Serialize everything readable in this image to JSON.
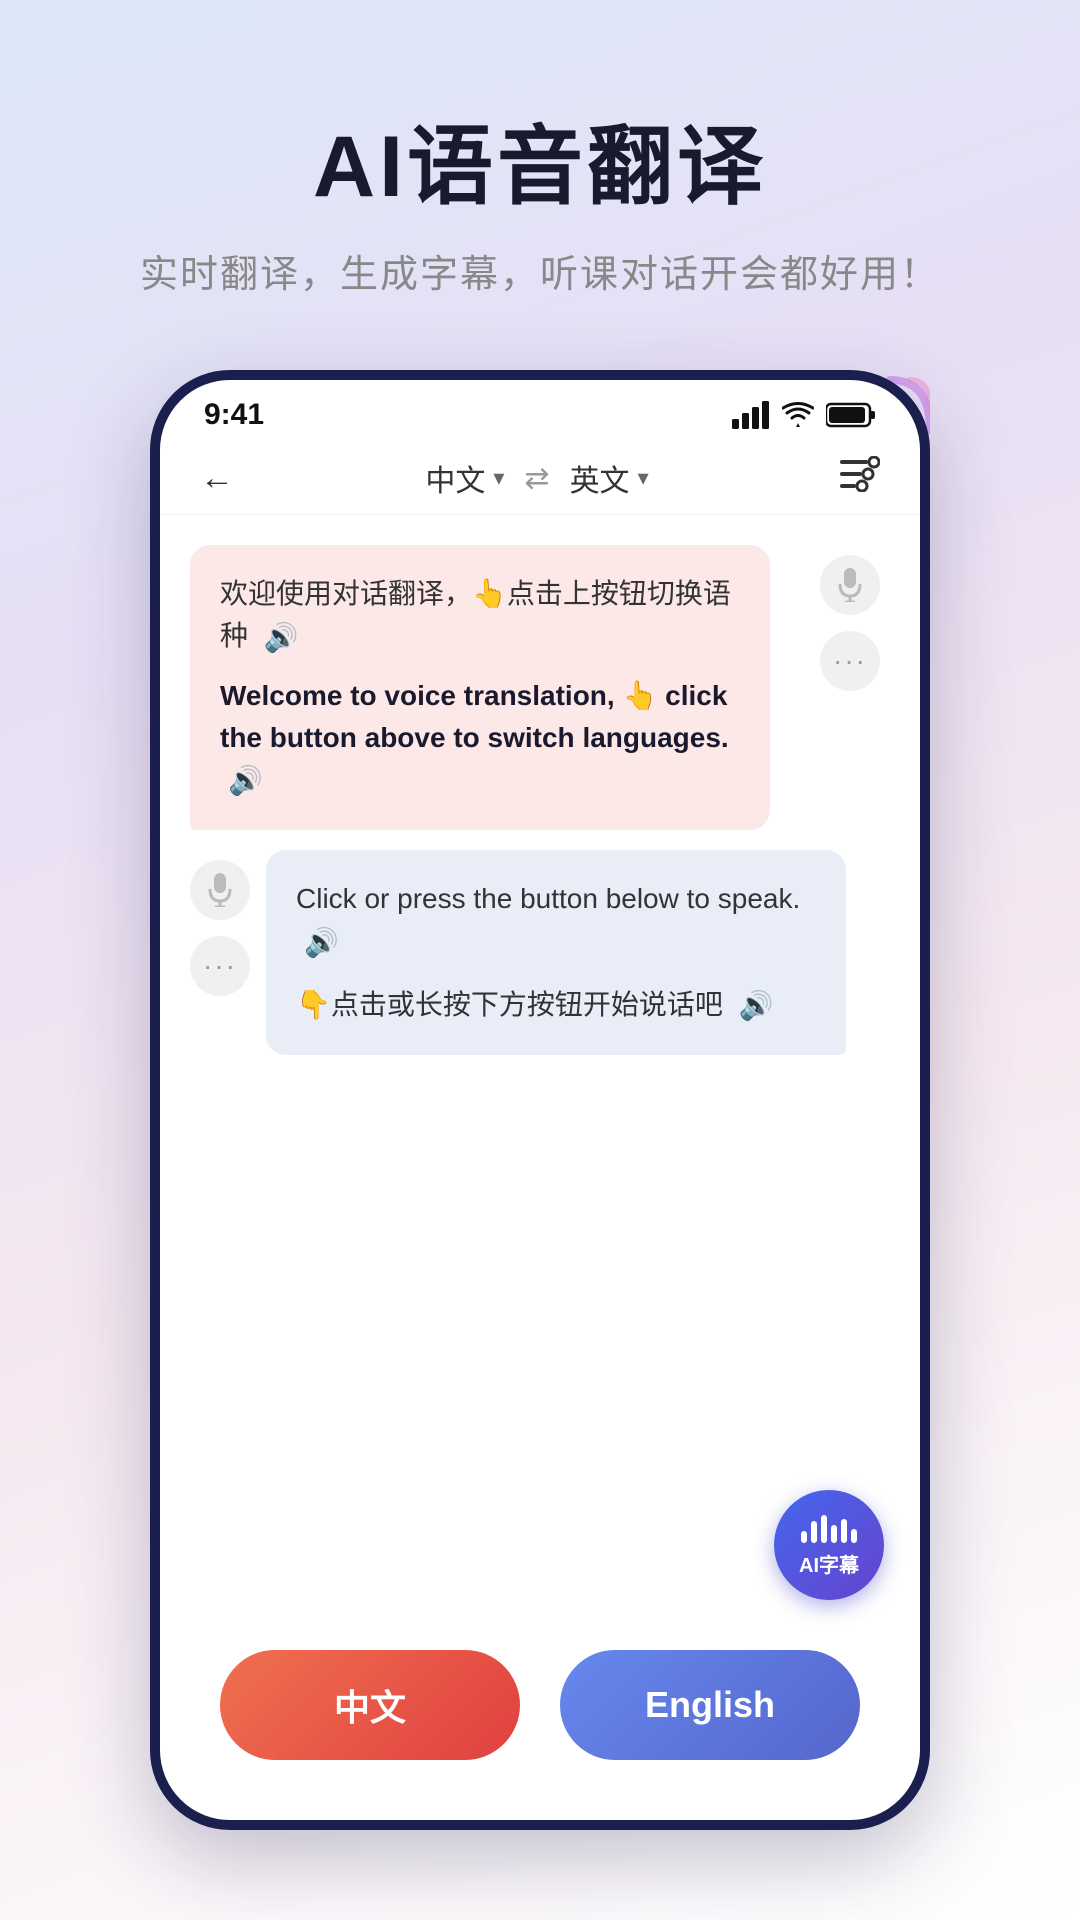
{
  "page": {
    "main_title": "AI语音翻译",
    "sub_title": "实时翻译，生成字幕，听课对话开会都好用！"
  },
  "status_bar": {
    "time": "9:41"
  },
  "nav": {
    "lang_left": "中文",
    "lang_right": "英文",
    "back_arrow": "←",
    "swap_icon": "⇄"
  },
  "bubble_left": {
    "cn_text": "欢迎使用对话翻译，👆点击上按钮切换语种",
    "en_text": "Welcome to voice translation, 👆 click the button above to switch languages."
  },
  "bubble_right": {
    "en_text": "Click or press the button below to speak.",
    "cn_text": "👇点击或长按下方按钮开始说话吧"
  },
  "ai_caption": {
    "label": "AI字幕"
  },
  "bottom_buttons": {
    "chinese_label": "中文",
    "english_label": "English"
  }
}
